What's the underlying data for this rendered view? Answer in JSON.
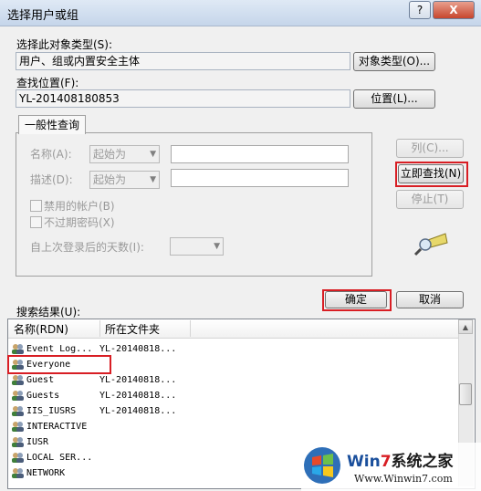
{
  "window": {
    "title": "选择用户或组",
    "help_label": "?",
    "close_label": "X"
  },
  "object_type": {
    "label": "选择此对象类型(S):",
    "value": "用户、组或内置安全主体",
    "button": "对象类型(O)..."
  },
  "location": {
    "label": "查找位置(F):",
    "value": "YL-201408180853",
    "button": "位置(L)..."
  },
  "query": {
    "tab_label": "一般性查询",
    "name_label": "名称(A):",
    "name_mode": "起始为",
    "desc_label": "描述(D):",
    "desc_mode": "起始为",
    "disabled_accounts": "禁用的帐户(B)",
    "no_expire_pwd": "不过期密码(X)",
    "days_label": "自上次登录后的天数(I):"
  },
  "buttons": {
    "columns": "列(C)...",
    "find_now": "立即查找(N)",
    "stop": "停止(T)",
    "ok": "确定",
    "cancel": "取消"
  },
  "results": {
    "label": "搜索结果(U):",
    "columns": [
      "名称(RDN)",
      "所在文件夹"
    ],
    "rows": [
      {
        "name": "Event Log...",
        "folder": "YL-20140818..."
      },
      {
        "name": "Everyone",
        "folder": ""
      },
      {
        "name": "Guest",
        "folder": "YL-20140818..."
      },
      {
        "name": "Guests",
        "folder": "YL-20140818..."
      },
      {
        "name": "IIS_IUSRS",
        "folder": "YL-20140818..."
      },
      {
        "name": "INTERACTIVE",
        "folder": ""
      },
      {
        "name": "IUSR",
        "folder": ""
      },
      {
        "name": "LOCAL SER...",
        "folder": ""
      },
      {
        "name": "NETWORK",
        "folder": ""
      }
    ]
  },
  "watermark": {
    "brand_part1": "Win",
    "brand_part2": "7",
    "brand_part3": "系统之家",
    "url": "Www.Winwin7.com"
  },
  "colors": {
    "highlight": "#d81e24",
    "accent": "#1a4f9c"
  }
}
